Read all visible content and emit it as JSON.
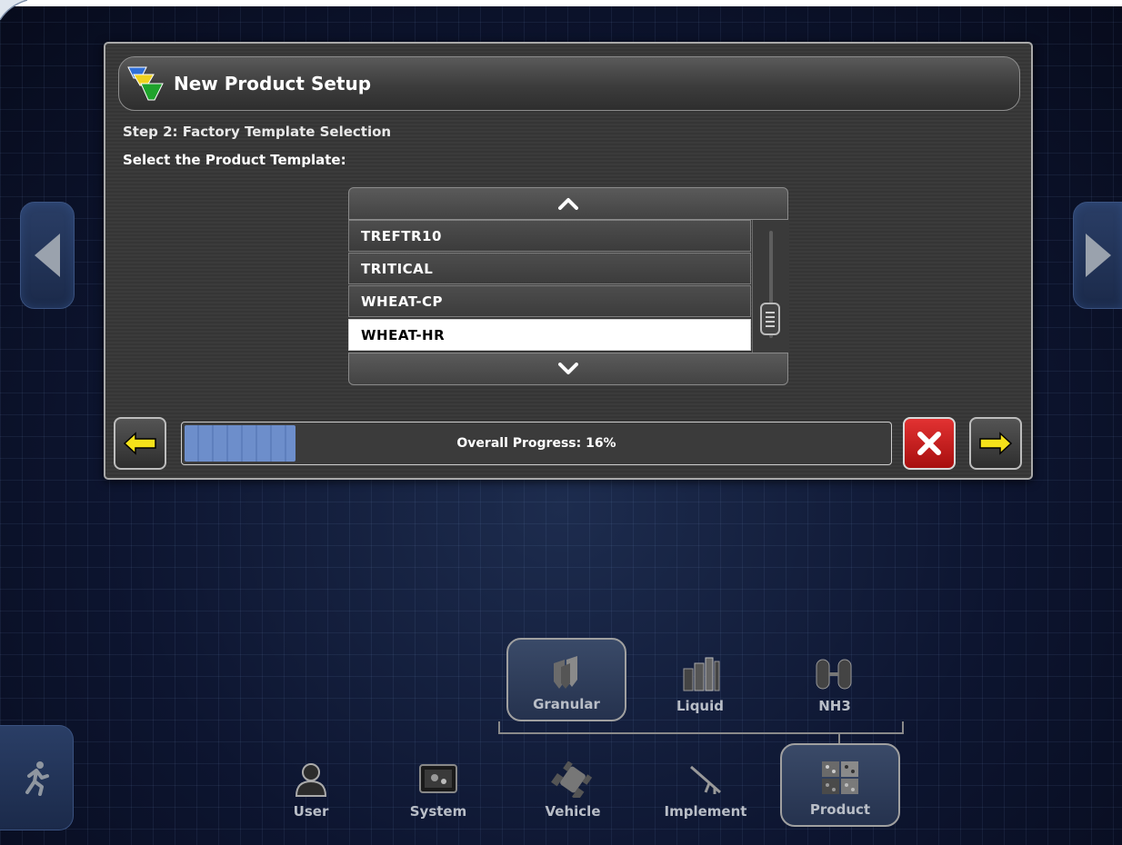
{
  "dialog": {
    "title": "New Product Setup",
    "step": "Step 2: Factory Template Selection",
    "prompt": "Select the Product Template:"
  },
  "template_list": {
    "items": [
      "TREFTR10",
      "TRITICAL",
      "WHEAT-CP",
      "WHEAT-HR"
    ],
    "selected": "WHEAT-HR"
  },
  "progress": {
    "label": "Overall Progress: 16%",
    "value_percent": 16
  },
  "product_types": [
    {
      "label": "Granular",
      "active": true
    },
    {
      "label": "Liquid",
      "active": false
    },
    {
      "label": "NH3",
      "active": false
    }
  ],
  "main_nav": [
    {
      "label": "User",
      "active": false
    },
    {
      "label": "System",
      "active": false
    },
    {
      "label": "Vehicle",
      "active": false
    },
    {
      "label": "Implement",
      "active": false
    },
    {
      "label": "Product",
      "active": true
    }
  ],
  "colors": {
    "cancel": "#c41a1a",
    "arrow": "#f5e21a",
    "progress_fill": "#6d8ecb",
    "selected_row": "#ffffff"
  },
  "icons": {
    "back": "arrow-left-icon",
    "next": "arrow-right-icon",
    "cancel": "close-icon",
    "exit": "running-man-icon"
  }
}
